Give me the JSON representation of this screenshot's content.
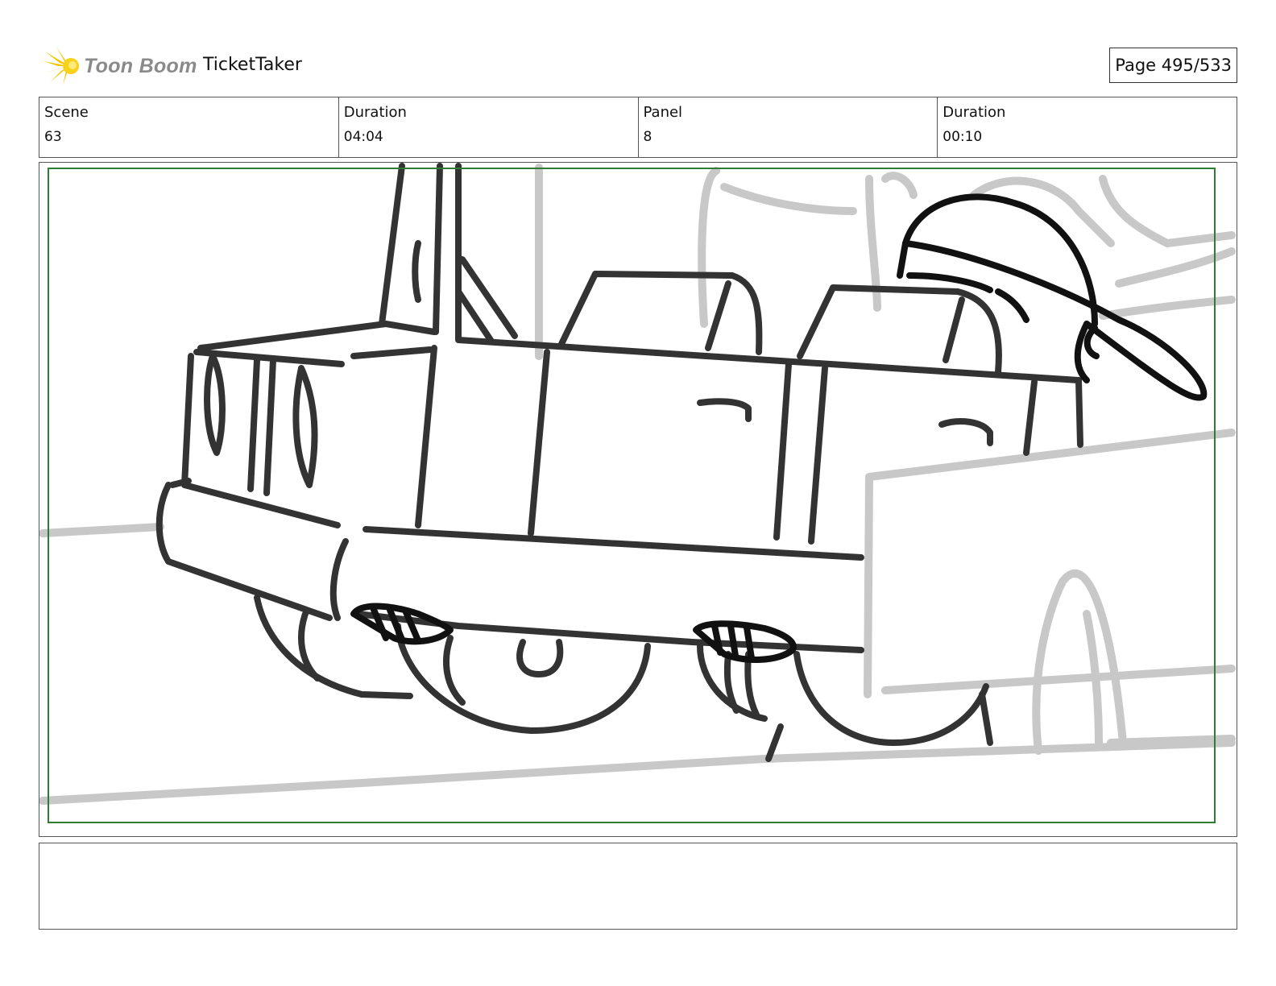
{
  "header": {
    "logo_text": "Toon Boom",
    "project_title": "TicketTaker",
    "page_indicator": "Page 495/533"
  },
  "info": [
    {
      "label": "Scene",
      "value": "63"
    },
    {
      "label": "Duration",
      "value": "04:04"
    },
    {
      "label": "Panel",
      "value": "8"
    },
    {
      "label": "Duration",
      "value": "00:10"
    }
  ],
  "colors": {
    "logo_yellow": "#f5c400",
    "frame_green": "#2e7d32",
    "sketch_dark": "#333333",
    "sketch_grey": "#c8c8c8"
  },
  "notes": ""
}
